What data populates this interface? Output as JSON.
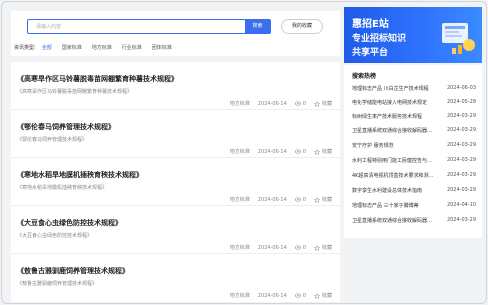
{
  "search": {
    "placeholder": "请输入内容",
    "button": "搜索",
    "favorites": "我的收藏"
  },
  "categories": {
    "label": "资讯类型:",
    "items": [
      "全部",
      "国家标准",
      "地方标准",
      "行业标准",
      "团体标准"
    ]
  },
  "articles": [
    {
      "title": "《高寒旱作区马铃薯脱毒苗网棚繁育种薯技术规程》",
      "desc": "《高寒旱作区马铃薯脱毒苗网棚繁育种薯技术规程》",
      "tag": "地方标准",
      "date": "2024-06-14",
      "views": "0",
      "fav": "收藏"
    },
    {
      "title": "《鄂伦春马饲养管理技术规程》",
      "desc": "《鄂伦春马饲养管理技术规程》",
      "tag": "地方标准",
      "date": "2024-06-14",
      "views": "0",
      "fav": "收藏"
    },
    {
      "title": "《寒地水稻旱地膜机插秧育秧技术规程》",
      "desc": "《寒地水稻旱地膜机插秧育秧技术规程》",
      "tag": "地方标准",
      "date": "2024-06-14",
      "views": "0",
      "fav": "收藏"
    },
    {
      "title": "《大豆食心虫绿色防控技术规程》",
      "desc": "《大豆食心虫绿色防控技术规程》",
      "tag": "地方标准",
      "date": "2024-06-14",
      "views": "0",
      "fav": "收藏"
    },
    {
      "title": "《敖鲁古雅驯鹿饲养管理技术规程》",
      "desc": "《敖鲁古雅驯鹿饲养管理技术规程》",
      "tag": "地方标准",
      "date": "2024-06-14",
      "views": "0",
      "fav": "收藏"
    }
  ],
  "banner": {
    "line1": "惠招E站",
    "line2": "专业招标知识",
    "line3": "共享平台",
    "accent": "#2563eb"
  },
  "hot": {
    "title": "搜索热榜",
    "items": [
      {
        "title": "地理标志产品 川白芷生产技术规程",
        "date": "2024-06-03"
      },
      {
        "title": "电化学储能电站接入电网技术规定",
        "date": "2024-05-28"
      },
      {
        "title": "标树绿生率产技术服务技术规程",
        "date": "2024-03-29"
      },
      {
        "title": "卫星直播系统双通综合接收解码器…",
        "date": "2024-03-29"
      },
      {
        "title": "安宁疗护 服务规范",
        "date": "2024-03-29"
      },
      {
        "title": "水利工程特别用门能工民健控告与…",
        "date": "2024-03-29"
      },
      {
        "title": "4K超高清电视机顶盒技术要求和测…",
        "date": "2024-03-29"
      },
      {
        "title": "数字孪生水利建设总体技术指南",
        "date": "2024-03-29"
      },
      {
        "title": "地理标志产品 三十家子膊博蒂",
        "date": "2024-04-10"
      },
      {
        "title": "卫星直播系统双通综合接收解码器…",
        "date": "2024-03-29"
      }
    ]
  }
}
